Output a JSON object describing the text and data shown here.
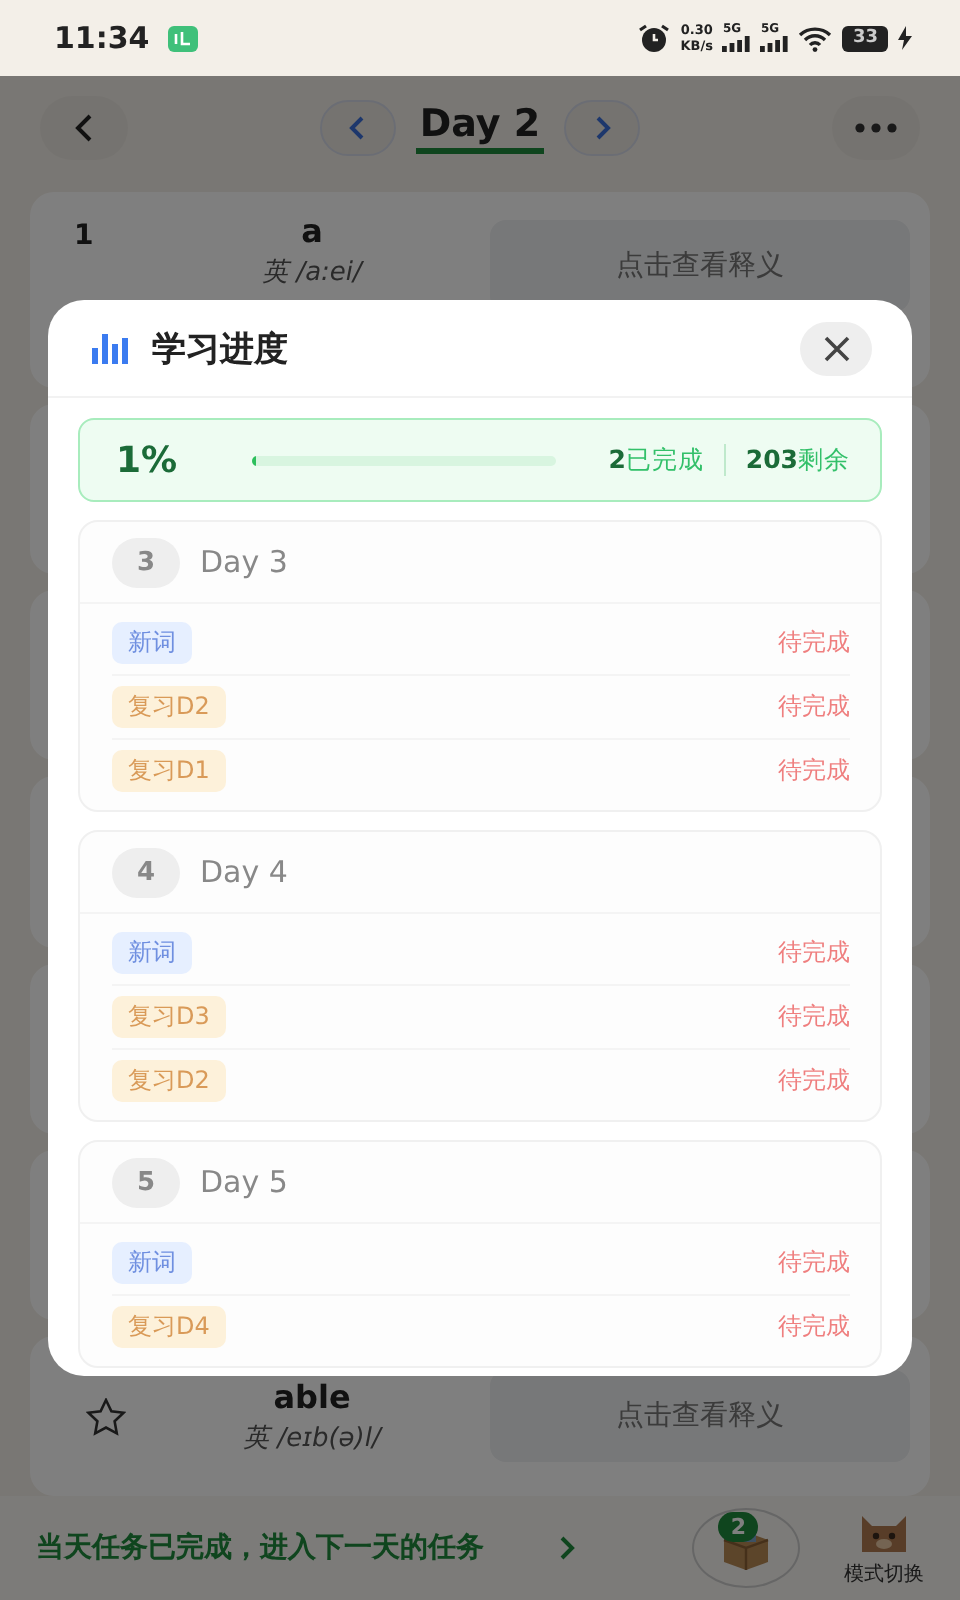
{
  "status_bar": {
    "time": "11:34",
    "net_speed": "0.30",
    "net_unit": "KB/s",
    "signal_1": "5G",
    "signal_2": "5G",
    "battery": "33"
  },
  "header": {
    "title": "Day 2"
  },
  "words": [
    {
      "index": "1",
      "word": "a",
      "phonetic": "英 /a:ei/",
      "hint": "点击查看释义"
    },
    {
      "word": "able",
      "phonetic": "英 /eɪb(ə)l/",
      "hint": "点击查看释义"
    }
  ],
  "bottom_bar": {
    "message": "当天任务已完成，进入下一天的任务",
    "badge": "2",
    "mode_label": "模式切换"
  },
  "modal": {
    "title": "学习进度",
    "percent": "1%",
    "level": 0.01,
    "done": "**2**已完成",
    "remaining": "**203**剩余",
    "days": [
      {
        "number": "3",
        "title": "Day 3",
        "tasks": [
          {
            "tag": "新词",
            "kind": "new",
            "status": "待完成"
          },
          {
            "tag": "复习D2",
            "kind": "review",
            "status": "待完成"
          },
          {
            "tag": "复习D1",
            "kind": "review",
            "status": "待完成"
          }
        ]
      },
      {
        "number": "4",
        "title": "Day 4",
        "tasks": [
          {
            "tag": "新词",
            "kind": "new",
            "status": "待完成"
          },
          {
            "tag": "复习D3",
            "kind": "review",
            "status": "待完成"
          },
          {
            "tag": "复习D2",
            "kind": "review",
            "status": "待完成"
          }
        ]
      },
      {
        "number": "5",
        "title": "Day 5",
        "tasks": [
          {
            "tag": "新词",
            "kind": "new",
            "status": "待完成"
          },
          {
            "tag": "复习D4",
            "kind": "review",
            "status": "待完成"
          }
        ]
      }
    ]
  }
}
